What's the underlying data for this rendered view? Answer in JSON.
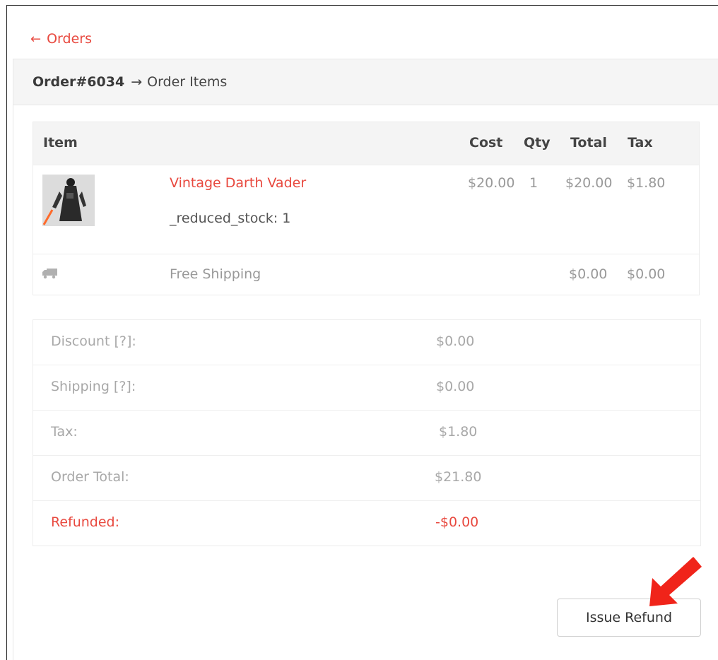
{
  "nav": {
    "back_arrow": "←",
    "back_label": "Orders"
  },
  "header": {
    "order_number": "Order#6034",
    "separator": "→",
    "section": "Order Items"
  },
  "items_table": {
    "columns": {
      "item": "Item",
      "cost": "Cost",
      "qty": "Qty",
      "total": "Total",
      "tax": "Tax"
    },
    "product": {
      "name": "Vintage Darth Vader",
      "meta": "_reduced_stock: 1",
      "cost": "$20.00",
      "qty": "1",
      "total": "$20.00",
      "tax": "$1.80",
      "thumbnail_icon": "darth-vader-figure-thumbnail"
    },
    "shipping": {
      "icon": "truck-icon",
      "label": "Free Shipping",
      "total": "$0.00",
      "tax": "$0.00"
    }
  },
  "totals": [
    {
      "label": "Discount [?]:",
      "value": "$0.00"
    },
    {
      "label": "Shipping [?]:",
      "value": "$0.00"
    },
    {
      "label": "Tax:",
      "value": "$1.80"
    },
    {
      "label": "Order Total:",
      "value": "$21.80"
    },
    {
      "label": "Refunded:",
      "value": "-$0.00"
    }
  ],
  "actions": {
    "issue_refund": "Issue Refund"
  },
  "colors": {
    "accent": "#e8493f",
    "annotation_arrow": "#f0241a"
  }
}
